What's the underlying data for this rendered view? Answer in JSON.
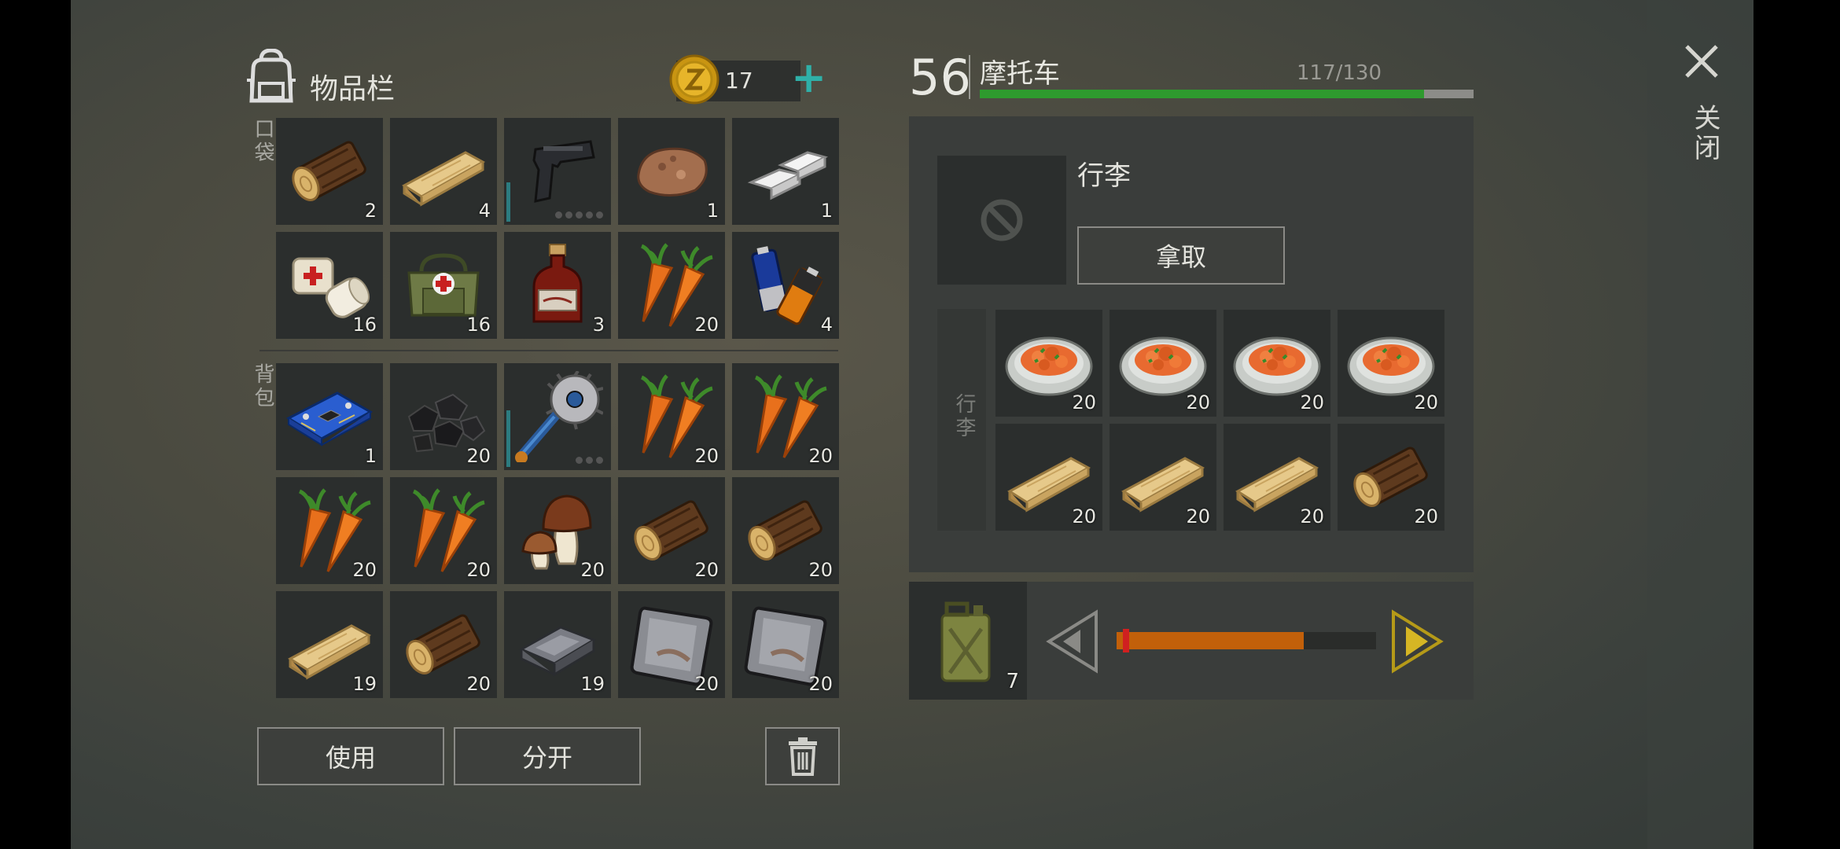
{
  "inventory": {
    "title": "物品栏",
    "coins": "17",
    "coin_icon": "z-coin-icon",
    "add_label": "+",
    "pocket_label": "口袋",
    "backpack_label": "背包",
    "pocket_items": [
      {
        "name": "log",
        "qty": "2"
      },
      {
        "name": "plank",
        "qty": "4"
      },
      {
        "name": "pistol",
        "qty": ""
      },
      {
        "name": "stone",
        "qty": "1"
      },
      {
        "name": "iron-bar",
        "qty": "1"
      },
      {
        "name": "bandage",
        "qty": "16"
      },
      {
        "name": "medkit-bag",
        "qty": "16"
      },
      {
        "name": "spirit-bottle",
        "qty": "3"
      },
      {
        "name": "carrot",
        "qty": "20"
      },
      {
        "name": "battery",
        "qty": "4"
      }
    ],
    "backpack_items": [
      {
        "name": "circuit-board",
        "qty": "1"
      },
      {
        "name": "coal",
        "qty": "20"
      },
      {
        "name": "saw-tool",
        "qty": ""
      },
      {
        "name": "carrot",
        "qty": "20"
      },
      {
        "name": "carrot",
        "qty": "20"
      },
      {
        "name": "carrot",
        "qty": "20"
      },
      {
        "name": "carrot",
        "qty": "20"
      },
      {
        "name": "mushroom",
        "qty": "20"
      },
      {
        "name": "log",
        "qty": "20"
      },
      {
        "name": "log",
        "qty": "20"
      },
      {
        "name": "plank",
        "qty": "19"
      },
      {
        "name": "log",
        "qty": "20"
      },
      {
        "name": "iron-ingot",
        "qty": "19"
      },
      {
        "name": "metal-plate",
        "qty": "20"
      },
      {
        "name": "metal-plate",
        "qty": "20"
      }
    ],
    "use_label": "使用",
    "split_label": "分开",
    "trash_icon": "trash-icon"
  },
  "vehicle": {
    "level": "56",
    "name": "摩托车",
    "durability_text": "117/130",
    "durability_fraction": 0.9,
    "luggage_title": "行李",
    "take_label": "拿取",
    "luggage_side_label": "行李",
    "luggage_items": [
      {
        "name": "food-plate",
        "qty": "20"
      },
      {
        "name": "food-plate",
        "qty": "20"
      },
      {
        "name": "food-plate",
        "qty": "20"
      },
      {
        "name": "food-plate",
        "qty": "20"
      },
      {
        "name": "plank",
        "qty": "20"
      },
      {
        "name": "plank",
        "qty": "20"
      },
      {
        "name": "plank",
        "qty": "20"
      },
      {
        "name": "log",
        "qty": "20"
      }
    ],
    "fuel_qty": "7",
    "fuel_fraction": 0.72
  },
  "close_label": "关闭",
  "colors": {
    "durability": "#2e9a2e",
    "fuel": "#c2600a",
    "arrow_active": "#b59a18"
  }
}
